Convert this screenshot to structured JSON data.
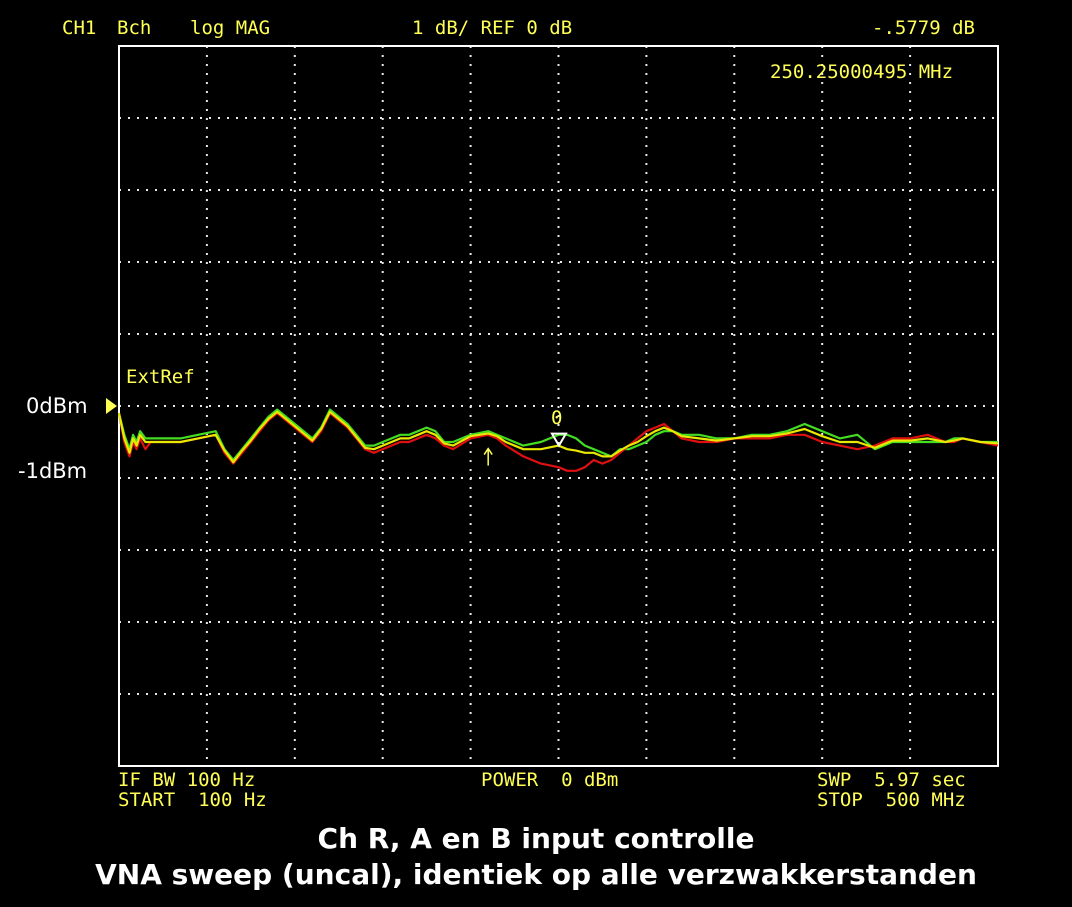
{
  "header": {
    "channel": "CH1",
    "measurement": "Bch",
    "format": "log MAG",
    "scale": "1 dB/ REF 0 dB",
    "marker_value": "-.5779 dB",
    "marker_freq": "250.25000495 MHz"
  },
  "annotations": {
    "ext_ref": "ExtRef",
    "marker_number": "0",
    "ref_label": "0dBm",
    "minus1_label": "-1dBm"
  },
  "footer": {
    "if_bw": "IF BW 100 Hz",
    "start": "START  100 Hz",
    "power": "POWER  0 dBm",
    "swp": "SWP  5.97 sec",
    "stop": "STOP  500 MHz"
  },
  "caption": {
    "line1": "Ch R, A en B input controlle",
    "line2": "VNA sweep (uncal), identiek op alle verzwakkerstanden"
  },
  "colors": {
    "background": "#000000",
    "frame": "#ffffff",
    "grid": "#e8e8e8",
    "text": "#ffff55",
    "trace_green": "#44dd22",
    "trace_red": "#e01010",
    "trace_yellow": "#e8e800"
  },
  "chart_data": {
    "type": "line",
    "x_unit": "MHz",
    "y_unit": "dB",
    "xlim": [
      0,
      500
    ],
    "ylim": [
      -5.0,
      5.0
    ],
    "ref_level": 0,
    "grid": true,
    "marker": {
      "x": 250.25,
      "y": -0.5779
    },
    "series": [
      {
        "color": "green",
        "x": [
          0,
          3,
          6,
          8,
          10,
          12,
          15,
          18,
          22,
          28,
          35,
          45,
          55,
          60,
          65,
          70,
          75,
          80,
          85,
          90,
          100,
          110,
          115,
          120,
          130,
          140,
          145,
          150,
          160,
          165,
          170,
          175,
          180,
          185,
          190,
          200,
          210,
          215,
          220,
          230,
          240,
          250,
          255,
          260,
          265,
          270,
          275,
          280,
          285,
          290,
          295,
          300,
          305,
          310,
          315,
          320,
          330,
          340,
          350,
          360,
          370,
          380,
          390,
          400,
          410,
          420,
          430,
          440,
          450,
          460,
          470,
          475,
          480,
          490,
          500
        ],
        "y": [
          -0.1,
          -0.4,
          -0.6,
          -0.4,
          -0.5,
          -0.35,
          -0.45,
          -0.45,
          -0.45,
          -0.45,
          -0.45,
          -0.4,
          -0.35,
          -0.6,
          -0.75,
          -0.6,
          -0.45,
          -0.3,
          -0.15,
          -0.05,
          -0.25,
          -0.45,
          -0.3,
          -0.05,
          -0.25,
          -0.55,
          -0.55,
          -0.5,
          -0.4,
          -0.4,
          -0.35,
          -0.3,
          -0.35,
          -0.5,
          -0.5,
          -0.4,
          -0.35,
          -0.4,
          -0.45,
          -0.55,
          -0.5,
          -0.4,
          -0.4,
          -0.45,
          -0.55,
          -0.6,
          -0.65,
          -0.7,
          -0.6,
          -0.6,
          -0.55,
          -0.5,
          -0.4,
          -0.35,
          -0.35,
          -0.4,
          -0.4,
          -0.45,
          -0.45,
          -0.4,
          -0.4,
          -0.35,
          -0.25,
          -0.35,
          -0.45,
          -0.4,
          -0.6,
          -0.5,
          -0.5,
          -0.5,
          -0.5,
          -0.45,
          -0.45,
          -0.5,
          -0.5
        ]
      },
      {
        "color": "red",
        "x": [
          0,
          3,
          6,
          8,
          10,
          12,
          15,
          18,
          22,
          28,
          35,
          45,
          55,
          60,
          65,
          70,
          75,
          80,
          85,
          90,
          100,
          110,
          115,
          120,
          130,
          140,
          145,
          150,
          160,
          165,
          170,
          175,
          180,
          185,
          190,
          200,
          210,
          215,
          220,
          230,
          240,
          250,
          255,
          260,
          265,
          270,
          275,
          280,
          285,
          290,
          295,
          300,
          305,
          310,
          315,
          320,
          330,
          340,
          350,
          360,
          370,
          380,
          390,
          400,
          410,
          420,
          430,
          440,
          450,
          460,
          470,
          475,
          480,
          490,
          500
        ],
        "y": [
          -0.1,
          -0.5,
          -0.7,
          -0.5,
          -0.6,
          -0.45,
          -0.6,
          -0.5,
          -0.5,
          -0.5,
          -0.5,
          -0.45,
          -0.4,
          -0.65,
          -0.8,
          -0.65,
          -0.5,
          -0.35,
          -0.2,
          -0.1,
          -0.3,
          -0.5,
          -0.35,
          -0.1,
          -0.3,
          -0.6,
          -0.65,
          -0.6,
          -0.5,
          -0.5,
          -0.45,
          -0.4,
          -0.45,
          -0.55,
          -0.6,
          -0.45,
          -0.4,
          -0.45,
          -0.55,
          -0.7,
          -0.8,
          -0.85,
          -0.9,
          -0.9,
          -0.85,
          -0.75,
          -0.8,
          -0.75,
          -0.65,
          -0.55,
          -0.45,
          -0.35,
          -0.3,
          -0.25,
          -0.35,
          -0.45,
          -0.5,
          -0.5,
          -0.45,
          -0.45,
          -0.45,
          -0.4,
          -0.4,
          -0.5,
          -0.55,
          -0.6,
          -0.55,
          -0.45,
          -0.45,
          -0.4,
          -0.5,
          -0.5,
          -0.45,
          -0.5,
          -0.55
        ]
      },
      {
        "color": "yellow",
        "x": [
          0,
          3,
          6,
          8,
          10,
          12,
          15,
          18,
          22,
          28,
          35,
          45,
          55,
          60,
          65,
          70,
          75,
          80,
          85,
          90,
          100,
          110,
          115,
          120,
          130,
          140,
          145,
          150,
          160,
          165,
          170,
          175,
          180,
          185,
          190,
          200,
          210,
          215,
          220,
          230,
          240,
          250,
          255,
          260,
          265,
          270,
          275,
          280,
          285,
          290,
          295,
          300,
          305,
          310,
          315,
          320,
          330,
          340,
          350,
          360,
          370,
          380,
          390,
          400,
          410,
          420,
          430,
          440,
          450,
          460,
          470,
          475,
          480,
          490,
          500
        ],
        "y": [
          -0.1,
          -0.45,
          -0.65,
          -0.45,
          -0.55,
          -0.4,
          -0.5,
          -0.5,
          -0.5,
          -0.5,
          -0.5,
          -0.45,
          -0.4,
          -0.62,
          -0.78,
          -0.62,
          -0.48,
          -0.32,
          -0.18,
          -0.08,
          -0.28,
          -0.48,
          -0.32,
          -0.08,
          -0.28,
          -0.58,
          -0.6,
          -0.55,
          -0.45,
          -0.45,
          -0.4,
          -0.35,
          -0.4,
          -0.52,
          -0.55,
          -0.42,
          -0.38,
          -0.42,
          -0.5,
          -0.6,
          -0.6,
          -0.55,
          -0.6,
          -0.62,
          -0.65,
          -0.65,
          -0.7,
          -0.7,
          -0.62,
          -0.55,
          -0.5,
          -0.42,
          -0.35,
          -0.3,
          -0.35,
          -0.42,
          -0.45,
          -0.48,
          -0.45,
          -0.42,
          -0.42,
          -0.38,
          -0.32,
          -0.42,
          -0.5,
          -0.5,
          -0.58,
          -0.48,
          -0.48,
          -0.45,
          -0.5,
          -0.48,
          -0.45,
          -0.5,
          -0.52
        ]
      }
    ]
  }
}
